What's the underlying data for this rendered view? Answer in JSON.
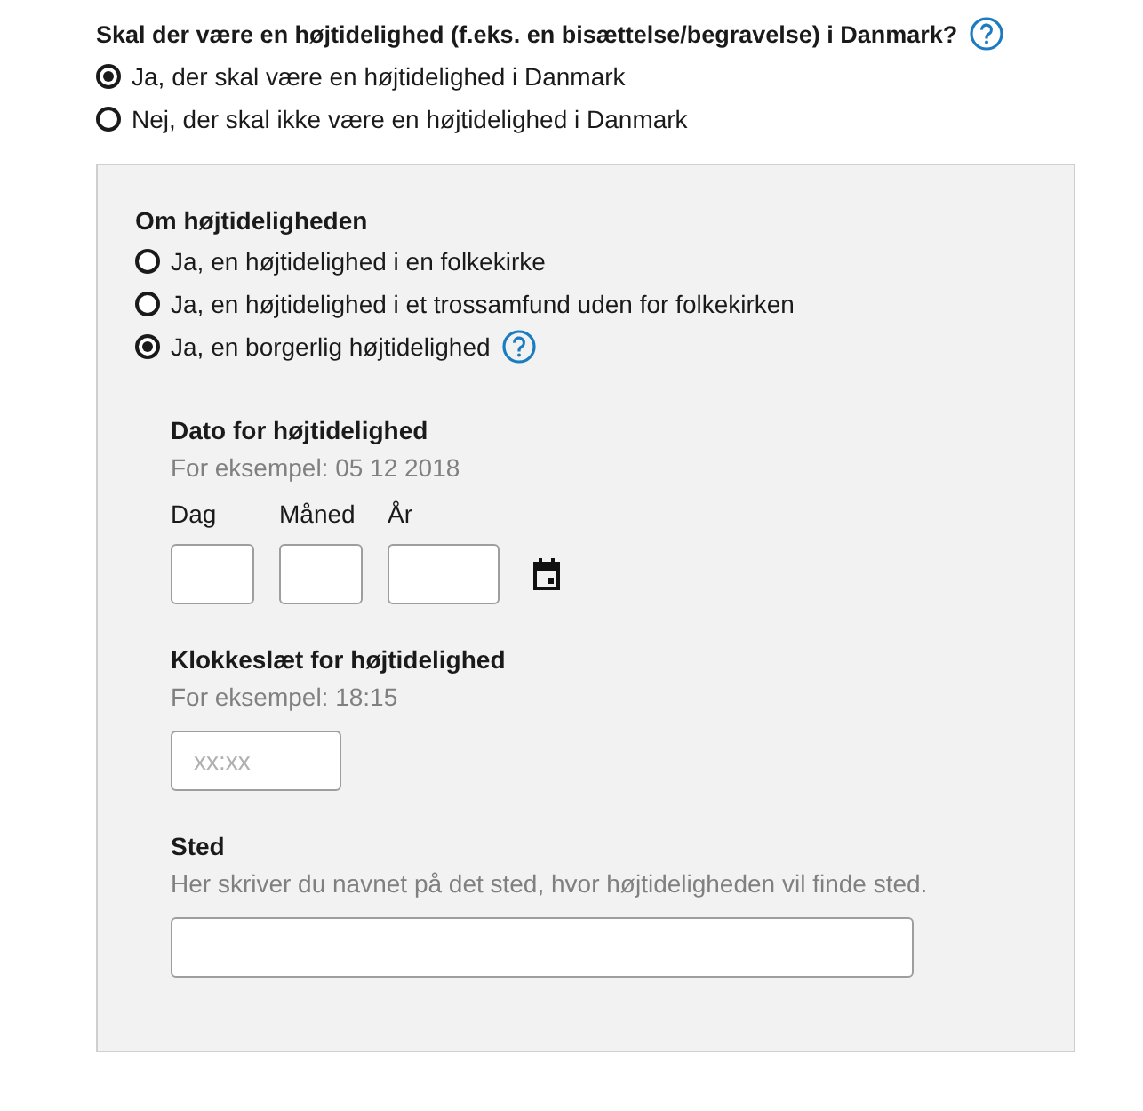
{
  "question": {
    "label": "Skal der være en højtidelighed (f.eks. en bisættelse/begravelse) i Danmark?",
    "help": true
  },
  "answers": [
    {
      "label": "Ja, der skal være en højtidelighed i Danmark",
      "selected": true
    },
    {
      "label": "Nej, der skal ikke være en højtidelighed i Danmark",
      "selected": false
    }
  ],
  "panel": {
    "heading": "Om højtideligheden",
    "options": [
      {
        "label": "Ja, en højtidelighed i en folkekirke",
        "selected": false,
        "help": false
      },
      {
        "label": "Ja, en højtidelighed i et trossamfund uden for folkekirken",
        "selected": false,
        "help": false
      },
      {
        "label": "Ja, en borgerlig højtidelighed",
        "selected": true,
        "help": true
      }
    ],
    "date": {
      "label": "Dato for højtidelighed",
      "hint": "For eksempel: 05 12 2018",
      "parts": [
        {
          "label": "Dag",
          "kind": "day"
        },
        {
          "label": "Måned",
          "kind": "month"
        },
        {
          "label": "År",
          "kind": "year"
        }
      ]
    },
    "time": {
      "label": "Klokkeslæt for højtidelighed",
      "hint": "For eksempel: 18:15",
      "placeholder": "xx:xx"
    },
    "place": {
      "label": "Sted",
      "hint": "Her skriver du navnet på det sted, hvor højtideligheden vil finde sted."
    }
  }
}
